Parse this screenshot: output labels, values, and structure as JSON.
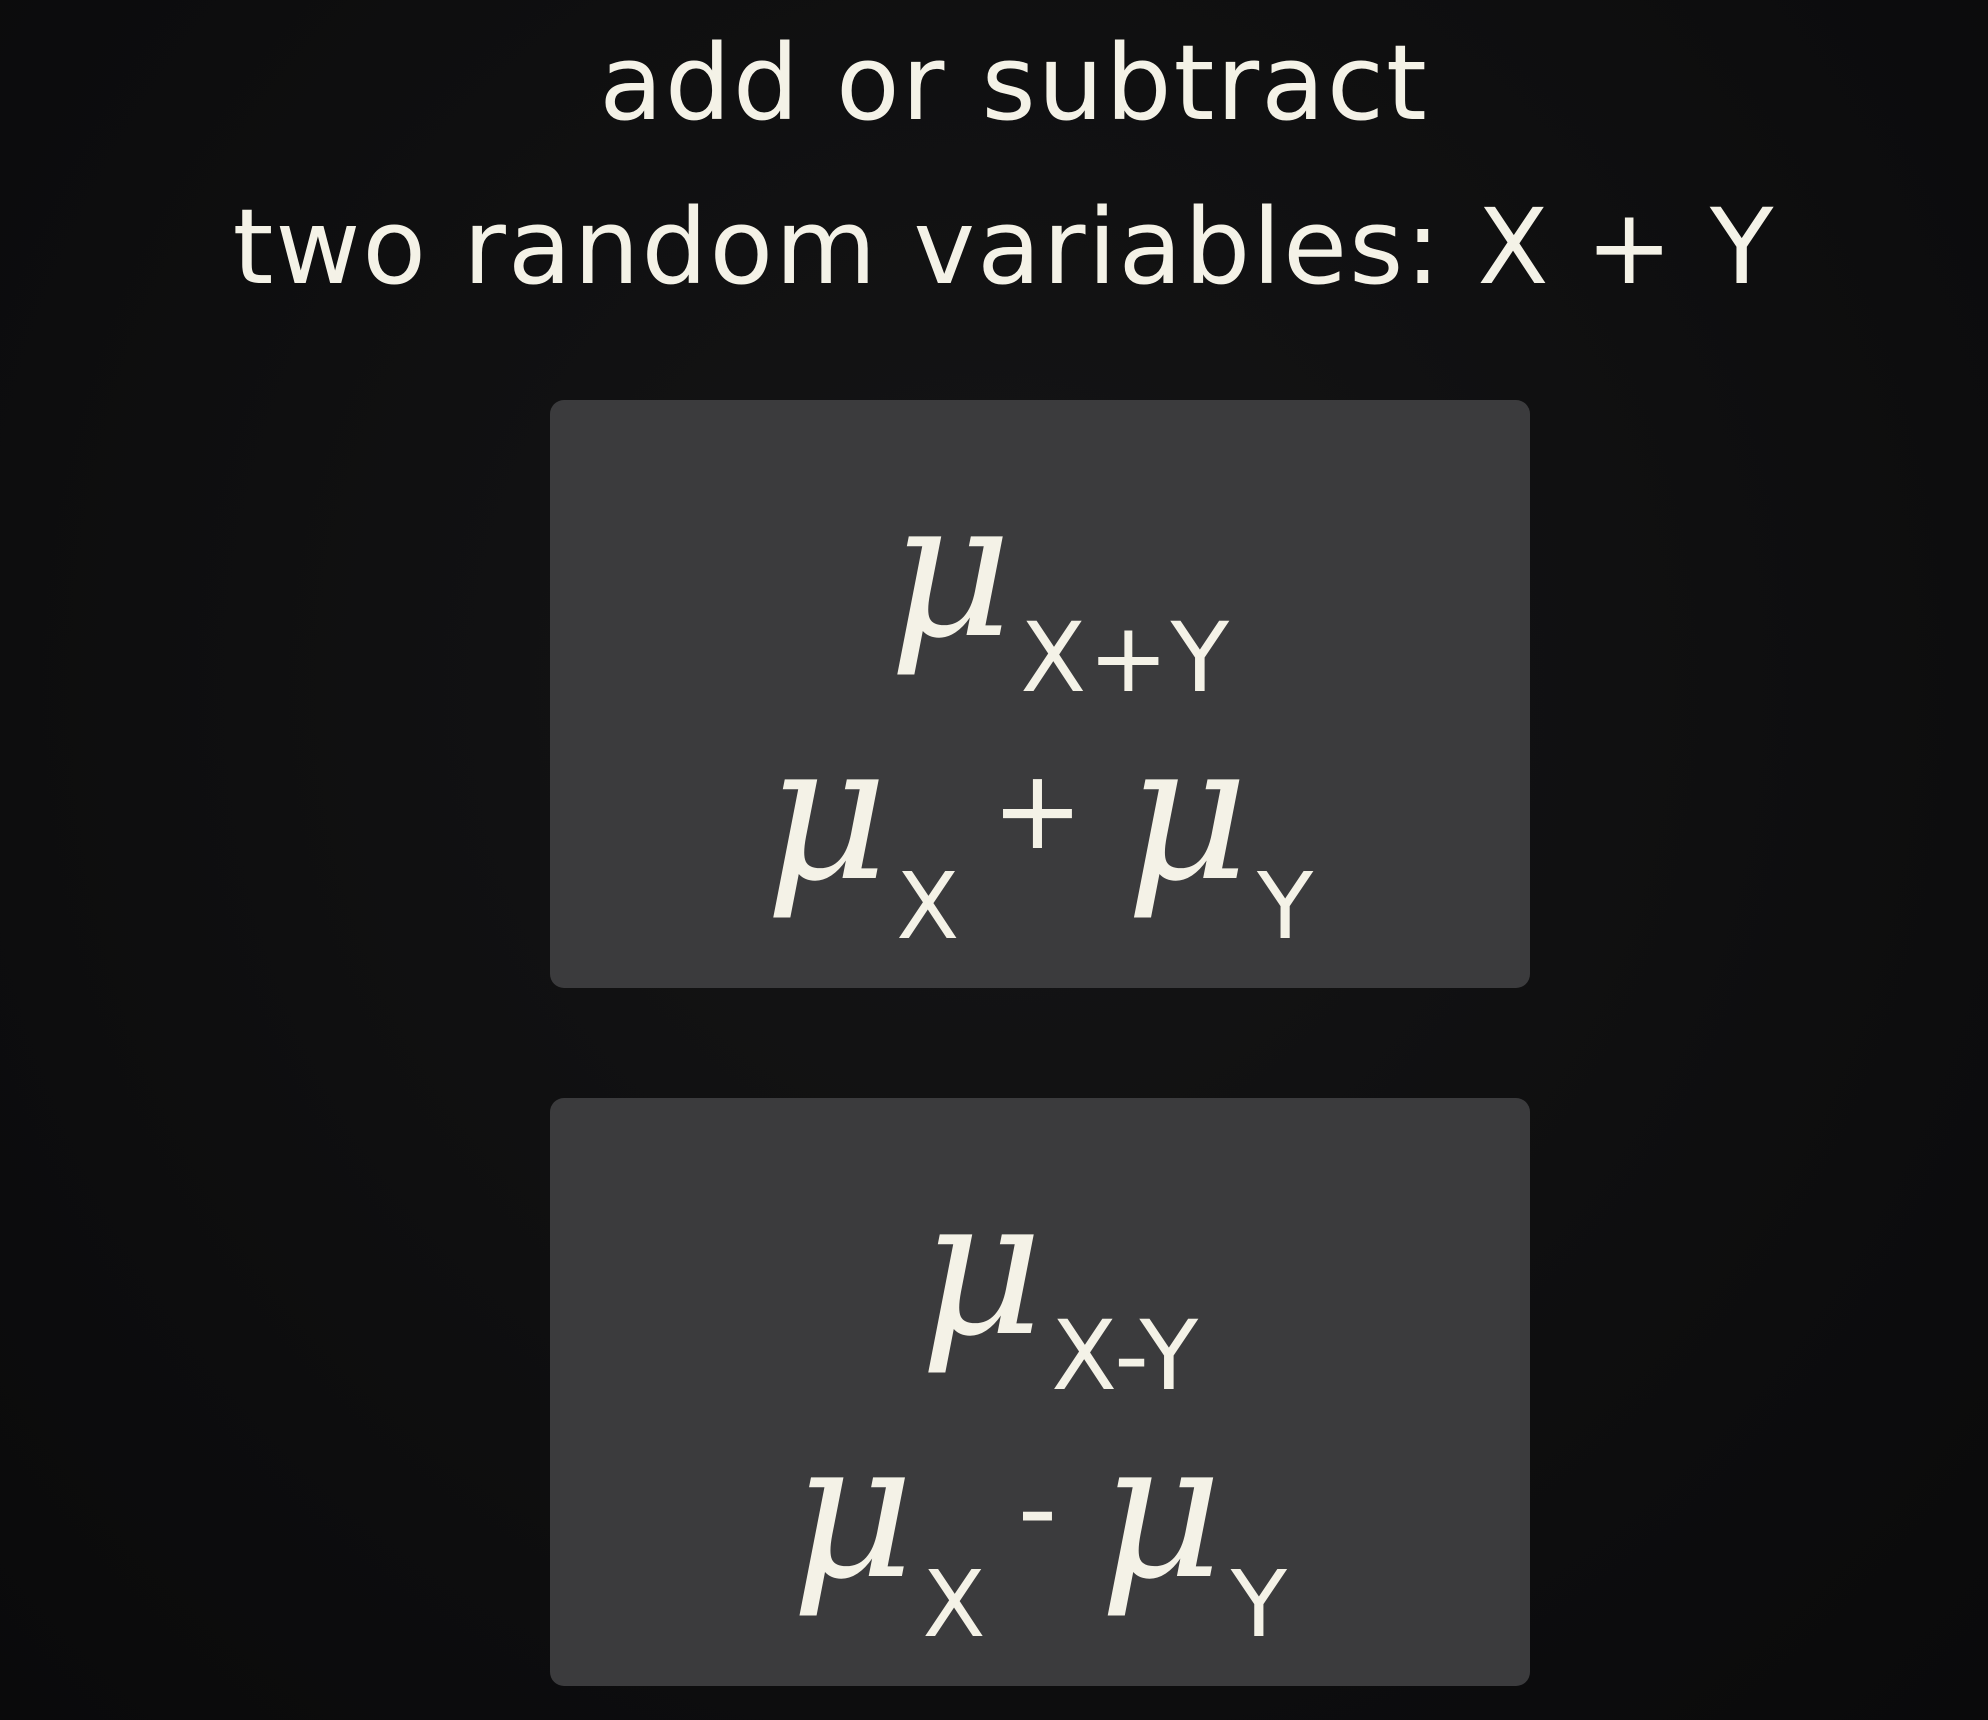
{
  "heading": {
    "line1": "add or subtract",
    "line2": "two random variables: X + Y"
  },
  "panels": {
    "sum": {
      "top": {
        "symbol": "μ",
        "subscript": "X+Y"
      },
      "bottom": {
        "left_symbol": "μ",
        "left_subscript": "X",
        "operator": "+",
        "right_symbol": "μ",
        "right_subscript": "Y"
      }
    },
    "difference": {
      "top": {
        "symbol": "μ",
        "subscript": "X-Y"
      },
      "bottom": {
        "left_symbol": "μ",
        "left_subscript": "X",
        "operator": "-",
        "right_symbol": "μ",
        "right_subscript": "Y"
      }
    }
  },
  "colors": {
    "background": "#0f0f10",
    "panel": "#3b3b3d",
    "chalk": "#f4f2e7"
  }
}
